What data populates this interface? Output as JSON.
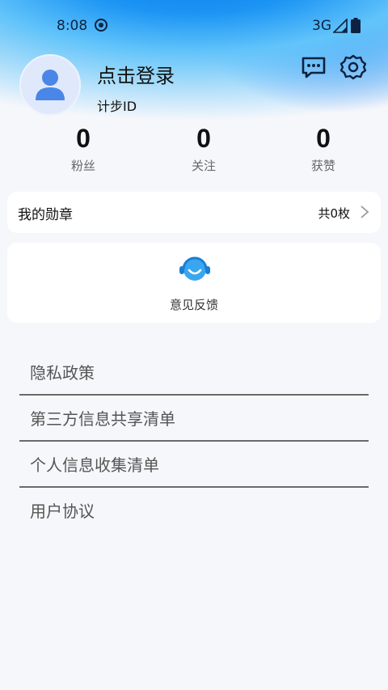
{
  "status_bar": {
    "time": "8:08",
    "network": "3G",
    "icons": [
      "camera-status-icon",
      "signal-icon",
      "battery-icon"
    ]
  },
  "profile": {
    "login_prompt": "点击登录",
    "user_id_label": "计步ID"
  },
  "header_actions": {
    "icons": [
      "message-icon",
      "gear-icon"
    ]
  },
  "stats": [
    {
      "value": "0",
      "label": "粉丝"
    },
    {
      "value": "0",
      "label": "关注"
    },
    {
      "value": "0",
      "label": "获赞"
    }
  ],
  "badges": {
    "title": "我的勋章",
    "count": "共0枚"
  },
  "feedback": {
    "label": "意见反馈",
    "icon": "customer-service-icon"
  },
  "menu": [
    {
      "label": "隐私政策"
    },
    {
      "label": "第三方信息共享清单"
    },
    {
      "label": "个人信息收集清单"
    },
    {
      "label": "用户协议"
    }
  ],
  "colors": {
    "accent": "#1c95f4",
    "icon_dark": "#0d2240",
    "avatar_blue": "#4a86e8"
  }
}
